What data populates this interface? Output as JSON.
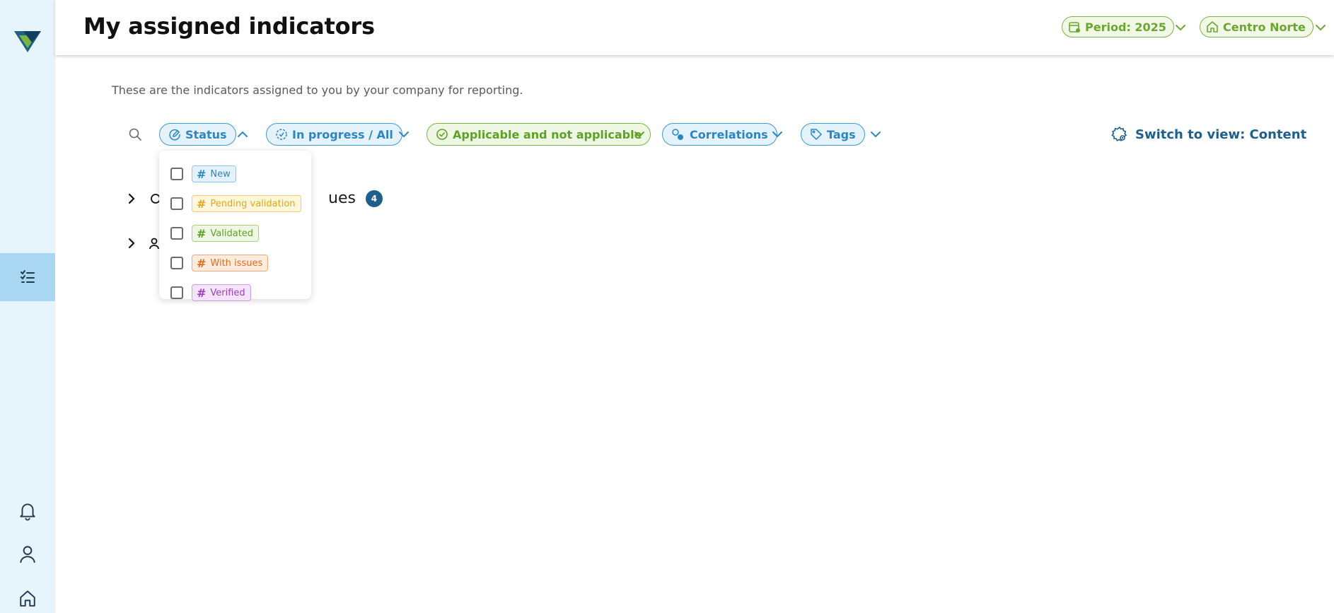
{
  "header": {
    "title": "My assigned indicators",
    "period_label": "Period: 2025",
    "location_label": "Centro Norte"
  },
  "content": {
    "subtitle": "These are the indicators assigned to you by your company for reporting.",
    "switch_view_label": "Switch to view: Content"
  },
  "filters": [
    {
      "label": "Status",
      "style": "blue",
      "icon": "pencil-circle-icon",
      "open": true
    },
    {
      "label": "In progress / All",
      "style": "blue",
      "icon": "dashed-circle-icon",
      "open": false
    },
    {
      "label": "Applicable and not applicable",
      "style": "green",
      "icon": "check-circle-icon",
      "open": false
    },
    {
      "label": "Correlations",
      "style": "blue",
      "icon": "correlation-icon",
      "open": false
    },
    {
      "label": "Tags",
      "style": "blue",
      "icon": "tag-icon",
      "open": false
    }
  ],
  "status_options": [
    {
      "label": "New",
      "color": "#2e86c1",
      "bg": "#e3f2fb",
      "border": "#8cc6ea"
    },
    {
      "label": "Pending validation",
      "color": "#e0a81c",
      "bg": "#fff6dc",
      "border": "#f2cf6e"
    },
    {
      "label": "Validated",
      "color": "#5fa026",
      "bg": "#eef7e3",
      "border": "#a8d27a"
    },
    {
      "label": "With issues",
      "color": "#dd6b20",
      "bg": "#fdebdd",
      "border": "#f0a878"
    },
    {
      "label": "Verified",
      "color": "#9b3fbf",
      "bg": "#f4e4fa",
      "border": "#cf9be3"
    }
  ],
  "groups": [
    {
      "label": "ues",
      "count": "4"
    },
    {
      "label": "",
      "count": ""
    }
  ],
  "colors": {
    "sidebar_bg": "#e8f4fb",
    "sidebar_active": "#a9d6f0",
    "brand_dark": "#1f5f8b",
    "accent_green": "#7cb342",
    "accent_blue": "#3d9ad1"
  }
}
